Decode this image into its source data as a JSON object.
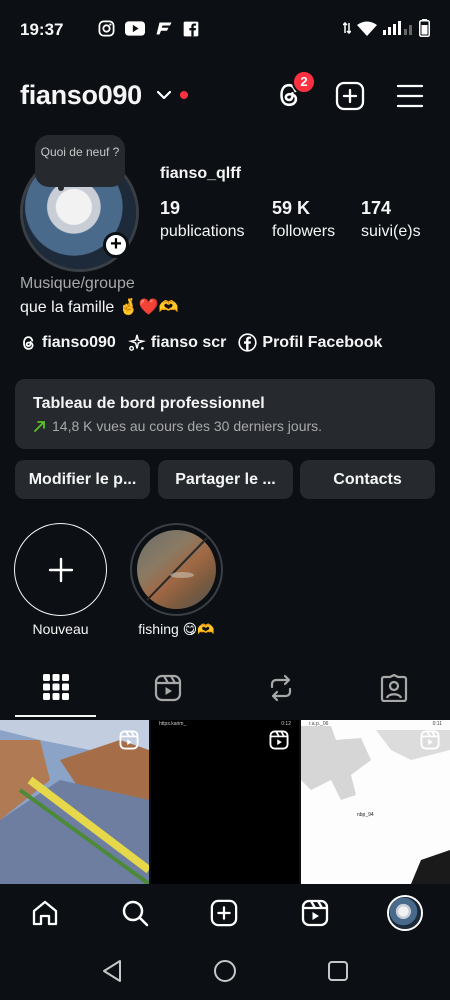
{
  "status_bar": {
    "time": "19:37"
  },
  "header": {
    "username": "fianso090",
    "threads_badge": "2"
  },
  "profile": {
    "note": "Quoi de neuf ?",
    "handle": "fianso_qlff",
    "stats": [
      {
        "value": "19",
        "label": "publications"
      },
      {
        "value": "59 K",
        "label": "followers"
      },
      {
        "value": "174",
        "label": "suivi(e)s"
      }
    ],
    "category": "Musique/groupe",
    "bio": "que la famille 🤞❤️🫶",
    "links": [
      {
        "label": "fianso090"
      },
      {
        "label": "fianso scr"
      },
      {
        "label": "Profil Facebook"
      }
    ]
  },
  "dashboard": {
    "title": "Tableau de bord professionnel",
    "subtitle": "14,8 K vues au cours des 30 derniers jours."
  },
  "buttons": {
    "edit": "Modifier le p...",
    "share": "Partager le ...",
    "contacts": "Contacts"
  },
  "highlights": [
    {
      "label": "Nouveau"
    },
    {
      "label": "fishing 😋🫶"
    }
  ],
  "grid": [
    {
      "caption": ""
    },
    {
      "caption": "https.karim_",
      "time": "0:12"
    },
    {
      "caption": "r.a.p._06",
      "time": "0:11",
      "inner": "nbp_94"
    }
  ],
  "colors": {
    "background": "#0c1014",
    "surface": "#262a2f",
    "accent_red": "#ff3040",
    "muted": "#a8a8a8"
  },
  "icons": [
    "threads-icon",
    "add-post-icon",
    "menu-icon",
    "grid-icon",
    "reels-tab-icon",
    "reposts-icon",
    "tagged-icon",
    "home-icon",
    "search-icon",
    "create-icon",
    "reels-icon",
    "profile-avatar"
  ]
}
